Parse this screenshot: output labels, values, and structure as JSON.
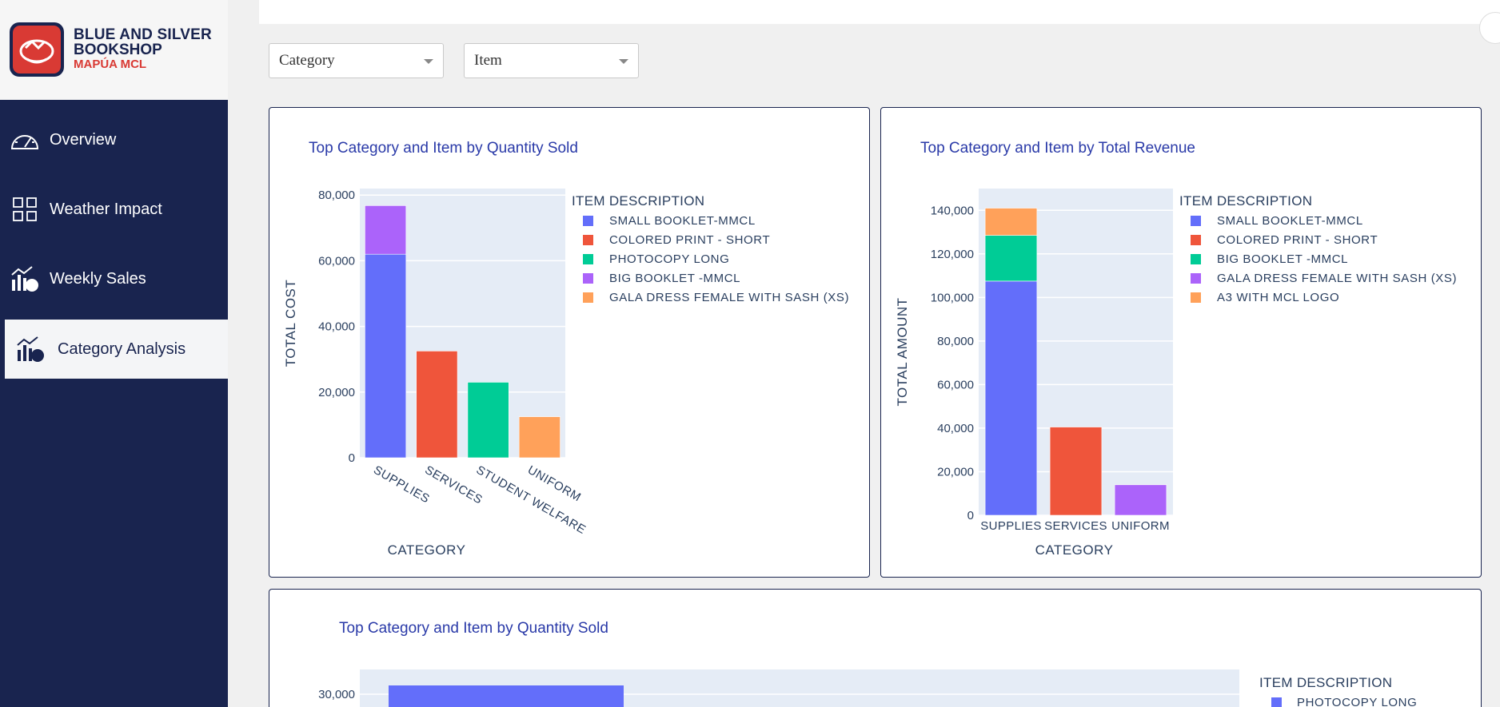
{
  "brand": {
    "line1": "BLUE AND SILVER",
    "line2": "BOOKSHOP",
    "line3": "MAPÚA MCL",
    "colors": {
      "navy": "#19244f",
      "red": "#d93a34"
    }
  },
  "nav": [
    {
      "label": "Overview",
      "icon": "gauge-icon"
    },
    {
      "label": "Weather Impact",
      "icon": "grid-icon"
    },
    {
      "label": "Weekly Sales",
      "icon": "chart-icon"
    },
    {
      "label": "Category Analysis",
      "icon": "chart-pie-icon",
      "active": true
    }
  ],
  "filters": {
    "category": {
      "value": "Category"
    },
    "item": {
      "value": "Item"
    }
  },
  "chart_data": [
    {
      "type": "bar",
      "title": "Top Category and Item by Quantity Sold",
      "xlabel": "CATEGORY",
      "ylabel": "TOTAL COST",
      "ylim": [
        0,
        82000
      ],
      "yticks": [
        0,
        20000,
        40000,
        60000,
        80000
      ],
      "ytick_labels": [
        "0",
        "20,000",
        "40,000",
        "60,000",
        "80,000"
      ],
      "categories": [
        "SUPPLIES",
        "SERVICES",
        "STUDENT WELFARE",
        "UNIFORM"
      ],
      "legend_title": "ITEM DESCRIPTION",
      "series": [
        {
          "name": "SMALL BOOKLET-MMCL",
          "color": "#636efa",
          "values": [
            62000,
            0,
            0,
            0
          ]
        },
        {
          "name": "COLORED PRINT - SHORT",
          "color": "#ef553b",
          "values": [
            0,
            32500,
            0,
            0
          ]
        },
        {
          "name": "PHOTOCOPY LONG",
          "color": "#00cc96",
          "values": [
            0,
            0,
            23000,
            0
          ]
        },
        {
          "name": "BIG BOOKLET -MMCL",
          "color": "#ab63fa",
          "values": [
            14800,
            0,
            0,
            0
          ]
        },
        {
          "name": "GALA DRESS FEMALE WITH SASH (XS)",
          "color": "#ffa15a",
          "values": [
            0,
            0,
            0,
            12500
          ]
        }
      ]
    },
    {
      "type": "bar",
      "title": "Top Category and Item by Total Revenue",
      "xlabel": "CATEGORY",
      "ylabel": "TOTAL AMOUNT",
      "ylim": [
        0,
        150000
      ],
      "yticks": [
        0,
        20000,
        40000,
        60000,
        80000,
        100000,
        120000,
        140000
      ],
      "ytick_labels": [
        "0",
        "20,000",
        "40,000",
        "60,000",
        "80,000",
        "100,000",
        "120,000",
        "140,000"
      ],
      "categories": [
        "SUPPLIES",
        "SERVICES",
        "UNIFORM"
      ],
      "legend_title": "ITEM DESCRIPTION",
      "series": [
        {
          "name": "SMALL BOOKLET-MMCL",
          "color": "#636efa",
          "values": [
            107500,
            0,
            0
          ]
        },
        {
          "name": "COLORED PRINT - SHORT",
          "color": "#ef553b",
          "values": [
            0,
            40500,
            0
          ]
        },
        {
          "name": "BIG BOOKLET -MMCL",
          "color": "#00cc96",
          "values": [
            21000,
            0,
            0
          ]
        },
        {
          "name": "GALA DRESS FEMALE WITH SASH (XS)",
          "color": "#ab63fa",
          "values": [
            0,
            0,
            14000
          ]
        },
        {
          "name": "A3 WITH MCL LOGO",
          "color": "#ffa15a",
          "values": [
            12500,
            0,
            0
          ]
        }
      ]
    },
    {
      "type": "bar",
      "title": "Top Category and Item by Quantity Sold",
      "ytick_labels": [
        "30,000"
      ],
      "legend_title": "ITEM DESCRIPTION",
      "series": [
        {
          "name": "PHOTOCOPY LONG",
          "color": "#636efa",
          "values": [
            32000
          ]
        }
      ]
    }
  ]
}
